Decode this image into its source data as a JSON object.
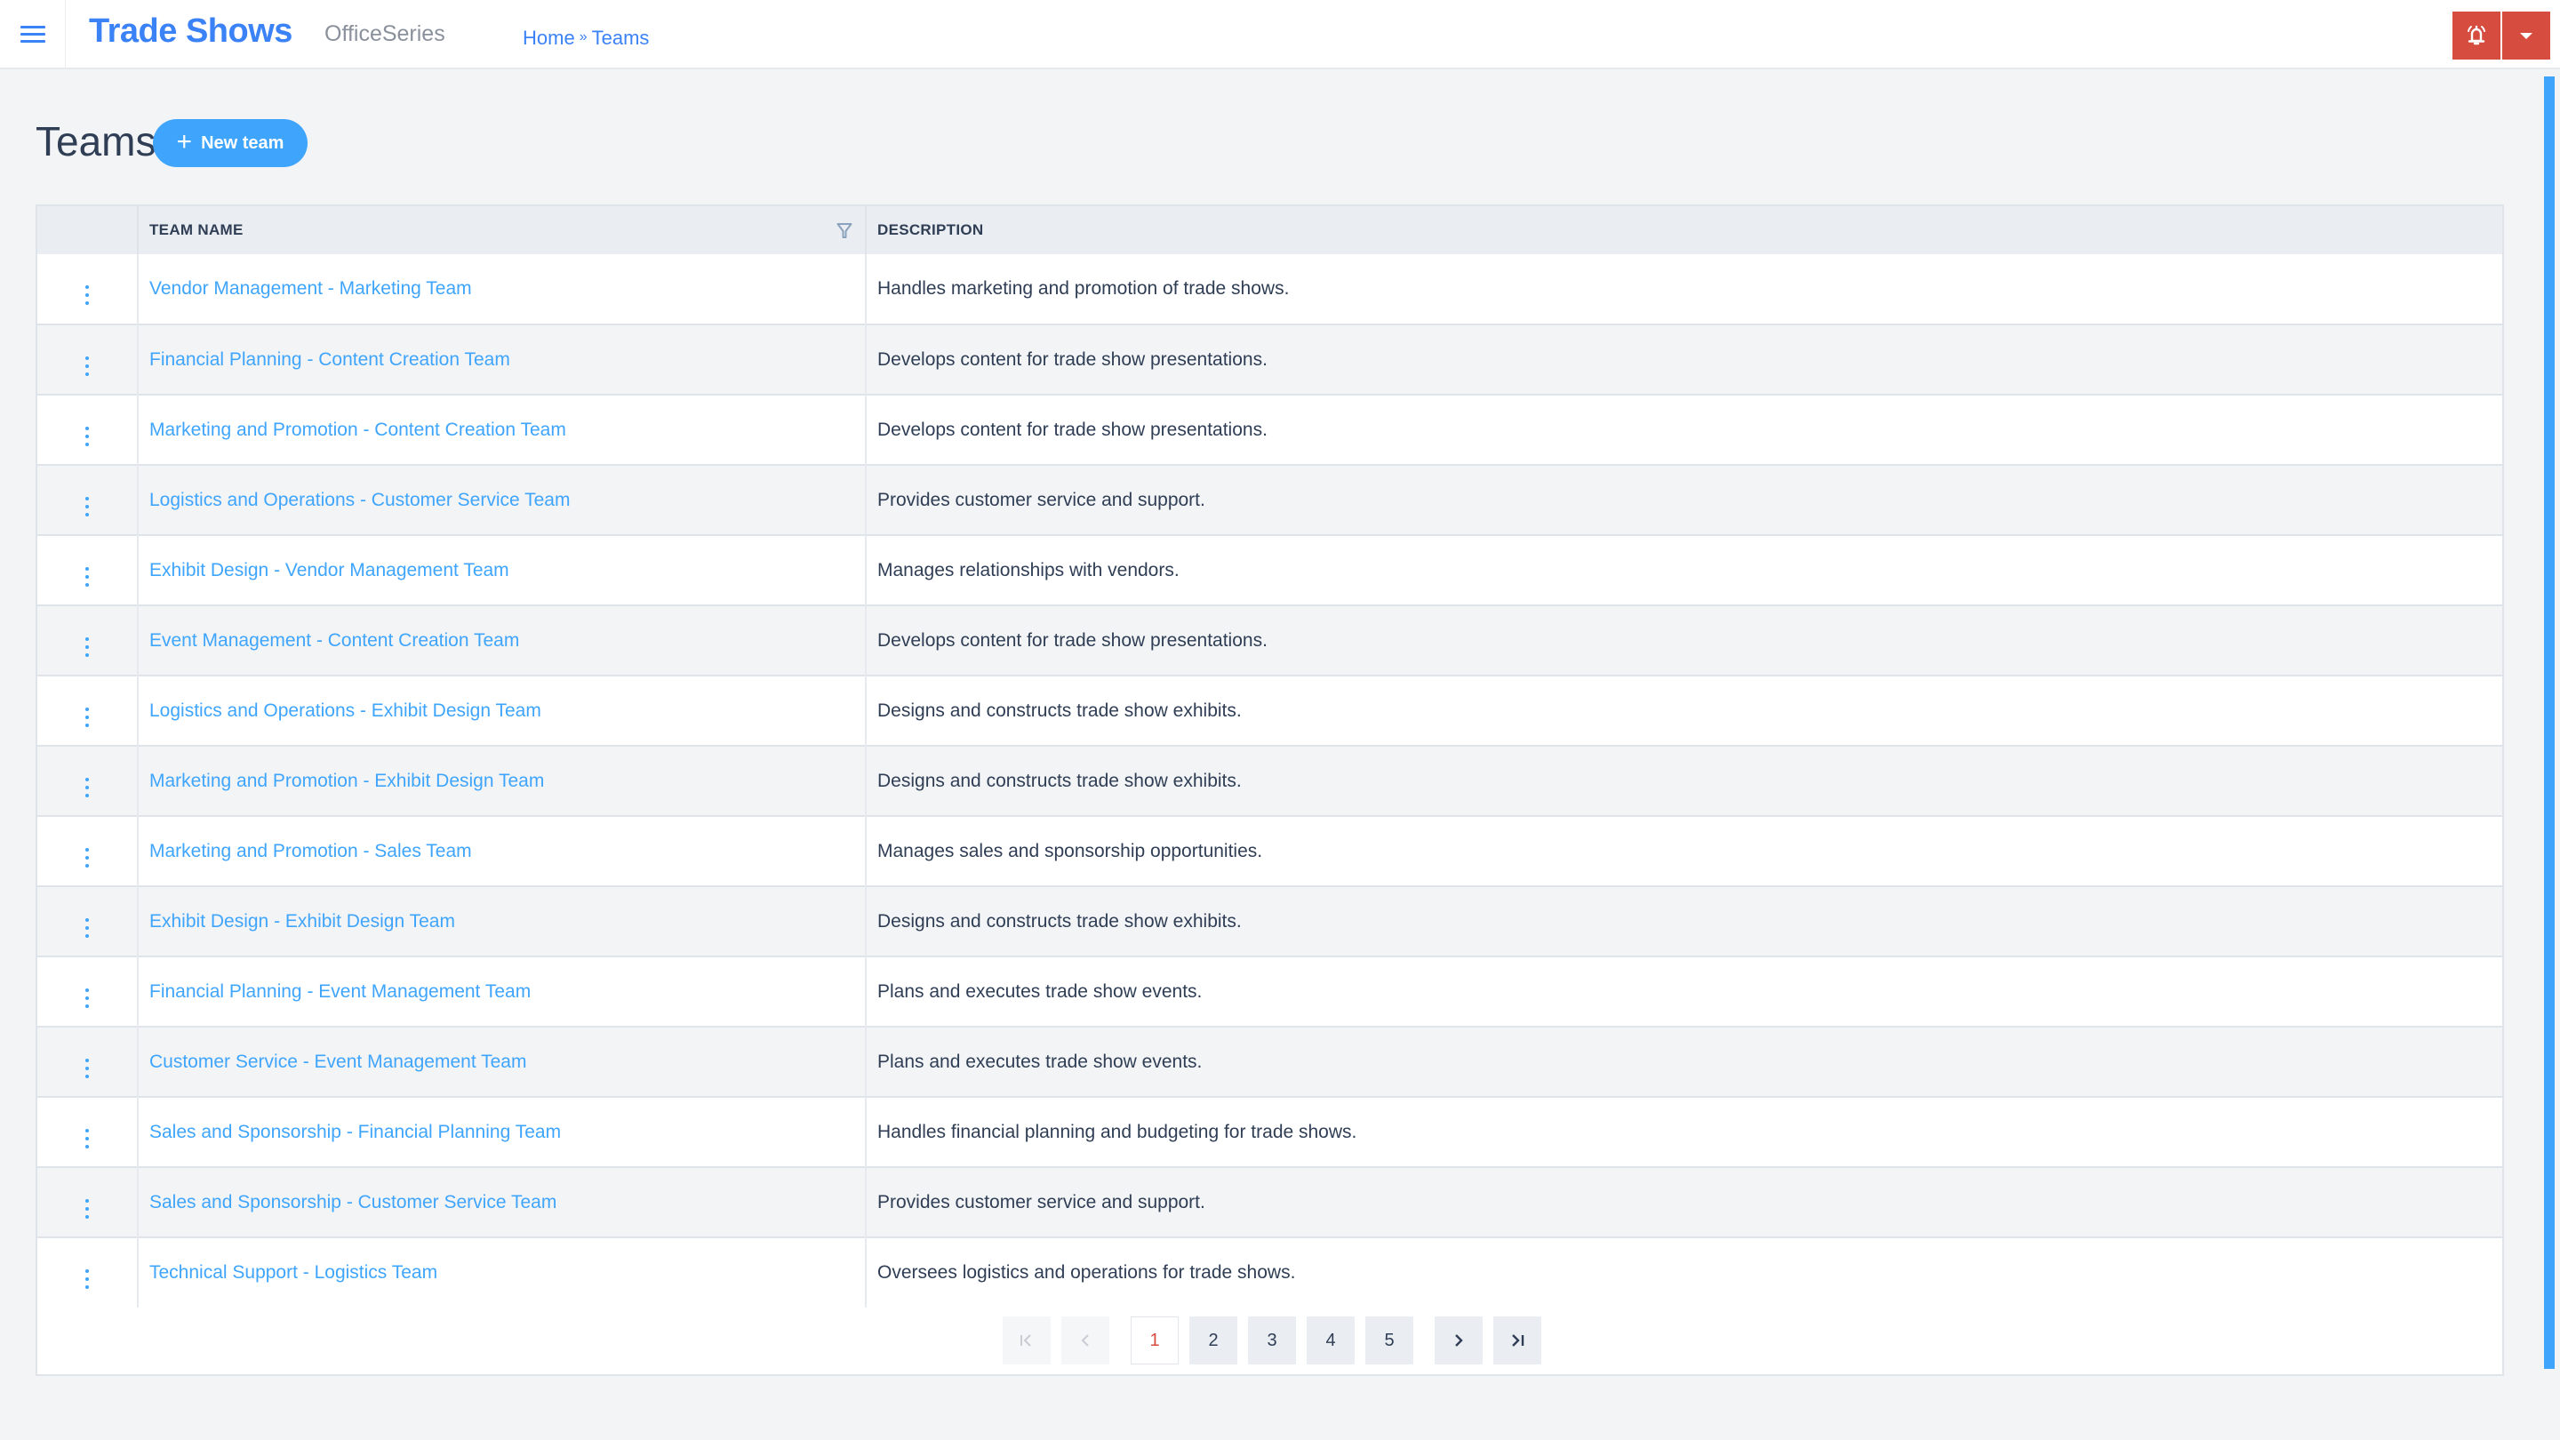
{
  "header": {
    "menu_icon": "hamburger-menu-icon",
    "app_title": "Trade Shows",
    "app_subtitle": "OfficeSeries",
    "breadcrumb": [
      {
        "label": "Home"
      },
      {
        "label": "Teams"
      }
    ],
    "breadcrumb_separator": "»",
    "notification_icon": "bell-ringing-icon",
    "dropdown_icon": "caret-down-icon"
  },
  "page": {
    "title": "Teams",
    "new_button_label": "New team",
    "new_button_icon": "plus-icon"
  },
  "table": {
    "columns": [
      {
        "label": ""
      },
      {
        "label": "TEAM NAME",
        "filter_icon": "filter-icon"
      },
      {
        "label": "DESCRIPTION"
      }
    ],
    "rows": [
      {
        "name": "Vendor Management - Marketing Team",
        "description": "Handles marketing and promotion of trade shows."
      },
      {
        "name": "Financial Planning - Content Creation Team",
        "description": "Develops content for trade show presentations."
      },
      {
        "name": "Marketing and Promotion - Content Creation Team",
        "description": "Develops content for trade show presentations."
      },
      {
        "name": "Logistics and Operations - Customer Service Team",
        "description": "Provides customer service and support."
      },
      {
        "name": "Exhibit Design - Vendor Management Team",
        "description": "Manages relationships with vendors."
      },
      {
        "name": "Event Management - Content Creation Team",
        "description": "Develops content for trade show presentations."
      },
      {
        "name": "Logistics and Operations - Exhibit Design Team",
        "description": "Designs and constructs trade show exhibits."
      },
      {
        "name": "Marketing and Promotion - Exhibit Design Team",
        "description": "Designs and constructs trade show exhibits."
      },
      {
        "name": "Marketing and Promotion - Sales Team",
        "description": "Manages sales and sponsorship opportunities."
      },
      {
        "name": "Exhibit Design - Exhibit Design Team",
        "description": "Designs and constructs trade show exhibits."
      },
      {
        "name": "Financial Planning - Event Management Team",
        "description": "Plans and executes trade show events."
      },
      {
        "name": "Customer Service - Event Management Team",
        "description": "Plans and executes trade show events."
      },
      {
        "name": "Sales and Sponsorship - Financial Planning Team",
        "description": "Handles financial planning and budgeting for trade shows."
      },
      {
        "name": "Sales and Sponsorship - Customer Service Team",
        "description": "Provides customer service and support."
      },
      {
        "name": "Technical Support - Logistics Team",
        "description": "Oversees logistics and operations for trade shows."
      }
    ],
    "row_action_icon": "kebab-menu-icon"
  },
  "pagination": {
    "current_page": 1,
    "pages": [
      "1",
      "2",
      "3",
      "4",
      "5"
    ],
    "first_icon": "first-page-icon",
    "prev_icon": "previous-page-icon",
    "next_icon": "next-page-icon",
    "last_icon": "last-page-icon"
  },
  "colors": {
    "brand": "#3b82f6",
    "accent": "#3fa5fc",
    "alert": "#d64c3f",
    "text": "#2f3e55",
    "background": "#f3f4f6"
  }
}
